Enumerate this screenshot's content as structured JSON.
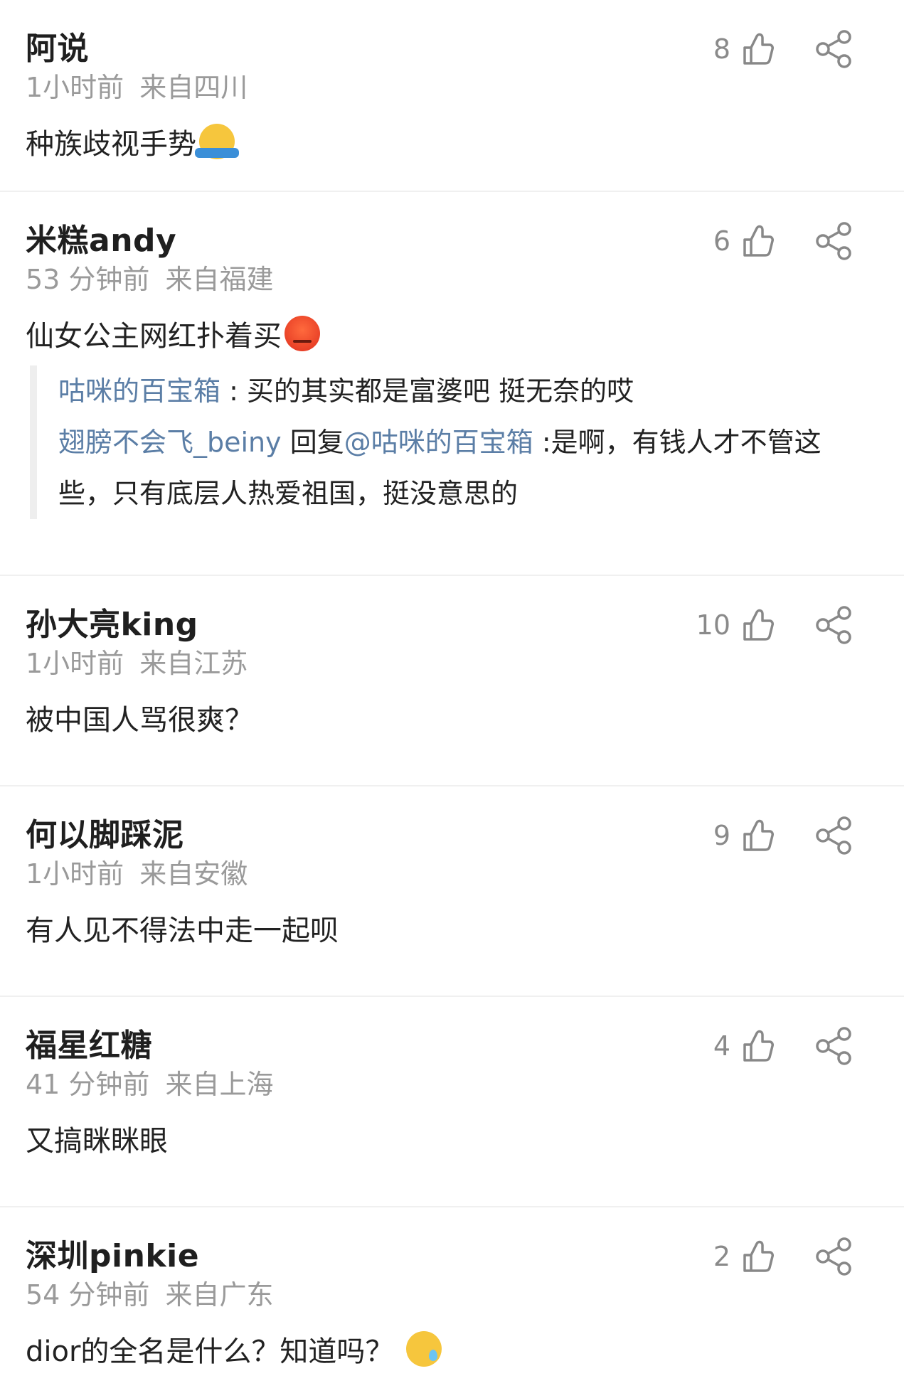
{
  "comments": [
    {
      "username": "阿说",
      "time": "1小时前",
      "location": "来自四川",
      "text": "种族歧视手势",
      "emoji": "shrug-emoji",
      "likes": "8"
    },
    {
      "username": "米糕andy",
      "time": "53 分钟前",
      "location": "来自福建",
      "text": "仙女公主网红扑着买",
      "emoji": "angry-emoji",
      "likes": "6",
      "replies": [
        {
          "author": "咕咪的百宝箱",
          "sep": " : ",
          "text": "买的其实都是富婆吧 挺无奈的哎"
        },
        {
          "author": "翅膀不会飞_beiny",
          "mid": " 回复",
          "mention": "@咕咪的百宝箱",
          "text": " :是啊，有钱人才不管这",
          "continued": "些，只有底层人热爱祖国，挺没意思的"
        }
      ]
    },
    {
      "username": "孙大亮king",
      "time": "1小时前",
      "location": "来自江苏",
      "text": "被中国人骂很爽？",
      "likes": "10"
    },
    {
      "username": "何以脚踩泥",
      "time": "1小时前",
      "location": "来自安徽",
      "text": "有人见不得法中走一起呗",
      "likes": "9"
    },
    {
      "username": "福星红糖",
      "time": "41 分钟前",
      "location": "来自上海",
      "text": "又搞眯眯眼",
      "likes": "4"
    },
    {
      "username": "深圳pinkie",
      "time": "54 分钟前",
      "location": "来自广东",
      "text": "dior的全名是什么？知道吗？",
      "emoji": "sweat-emoji",
      "likes": "2"
    }
  ],
  "icons": {
    "like": "thumbs-up-outline-icon",
    "share": "share-nodes-icon"
  },
  "colors": {
    "username": "#1f1f1f",
    "meta": "#9a9a9a",
    "link": "#5b7ea6",
    "divider": "#f0f0f0",
    "quote_bar": "#eeeeee"
  }
}
